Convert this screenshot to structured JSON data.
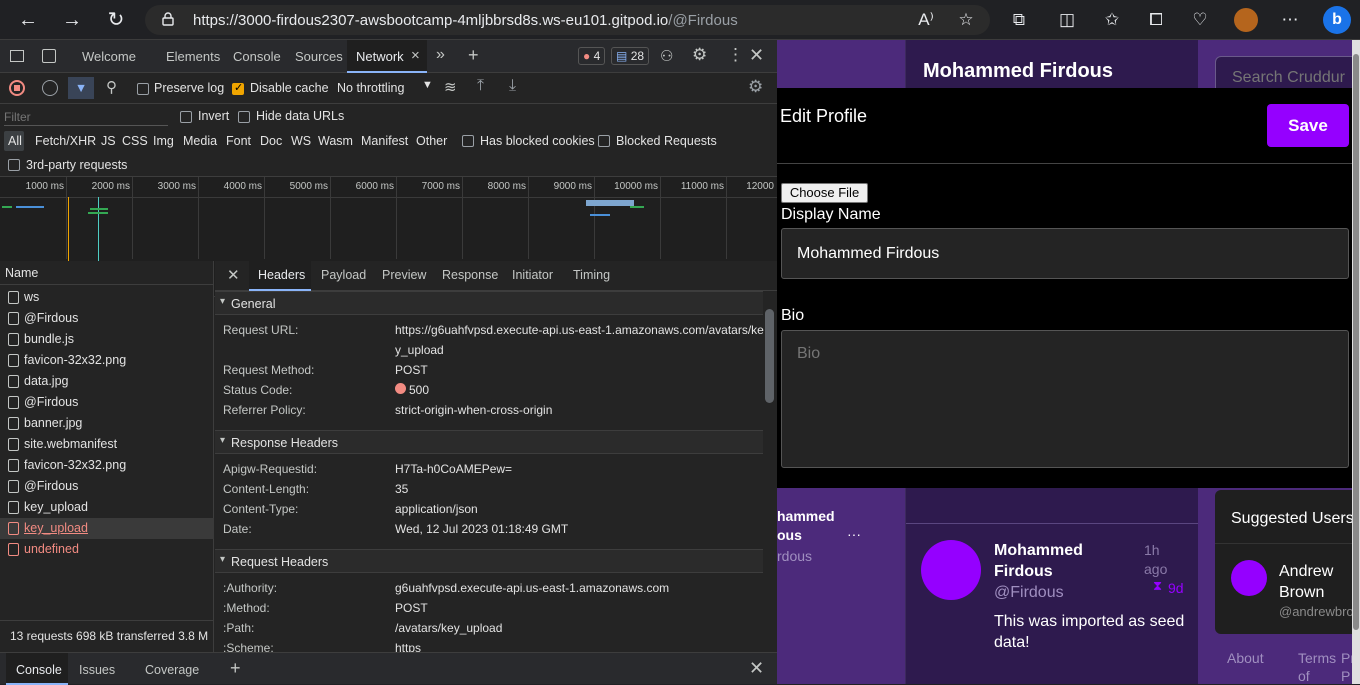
{
  "browser": {
    "url_host": "https://3000-firdous2307-awsbootcamp-4mljbbrsd8s.ws-eu101.gitpod.io",
    "url_path": "/@Firdous"
  },
  "devtools": {
    "tabs": [
      "Welcome",
      "Elements",
      "Console",
      "Sources",
      "Network"
    ],
    "active_tab": "Network",
    "error_count": "4",
    "message_count": "28",
    "toolbar": {
      "preserve_log": "Preserve log",
      "disable_cache": "Disable cache",
      "throttling": "No throttling"
    },
    "filter": {
      "placeholder": "Filter",
      "invert": "Invert",
      "hide_data_urls": "Hide data URLs",
      "types": [
        "All",
        "Fetch/XHR",
        "JS",
        "CSS",
        "Img",
        "Media",
        "Font",
        "Doc",
        "WS",
        "Wasm",
        "Manifest",
        "Other"
      ],
      "has_blocked_cookies": "Has blocked cookies",
      "blocked_requests": "Blocked Requests",
      "third_party": "3rd-party requests"
    },
    "timeline_ticks": [
      "1000 ms",
      "2000 ms",
      "3000 ms",
      "4000 ms",
      "5000 ms",
      "6000 ms",
      "7000 ms",
      "8000 ms",
      "9000 ms",
      "10000 ms",
      "11000 ms",
      "12000"
    ],
    "request_list": {
      "header": "Name",
      "items": [
        {
          "name": "ws",
          "error": false
        },
        {
          "name": "@Firdous",
          "error": false
        },
        {
          "name": "bundle.js",
          "error": false
        },
        {
          "name": "favicon-32x32.png",
          "error": false
        },
        {
          "name": "data.jpg",
          "error": false
        },
        {
          "name": "@Firdous",
          "error": false
        },
        {
          "name": "banner.jpg",
          "error": false
        },
        {
          "name": "site.webmanifest",
          "error": false
        },
        {
          "name": "favicon-32x32.png",
          "error": false
        },
        {
          "name": "@Firdous",
          "error": false
        },
        {
          "name": "key_upload",
          "error": false
        },
        {
          "name": "key_upload",
          "error": true
        },
        {
          "name": "undefined",
          "error": true
        }
      ],
      "footer": "13 requests   698 kB transferred   3.8 M"
    },
    "detail_tabs": [
      "Headers",
      "Payload",
      "Preview",
      "Response",
      "Initiator",
      "Timing"
    ],
    "general": {
      "title": "General",
      "request_url_k": "Request URL:",
      "request_url_v1": "https://g6uahfvpsd.execute-api.us-east-1.amazonaws.com/avatars/ke",
      "request_url_v2": "y_upload",
      "method_k": "Request Method:",
      "method_v": "POST",
      "status_k": "Status Code:",
      "status_v": "500",
      "referrer_k": "Referrer Policy:",
      "referrer_v": "strict-origin-when-cross-origin"
    },
    "response_headers": {
      "title": "Response Headers",
      "rows": [
        {
          "k": "Apigw-Requestid:",
          "v": "H7Ta-h0CoAMEPew="
        },
        {
          "k": "Content-Length:",
          "v": "35"
        },
        {
          "k": "Content-Type:",
          "v": "application/json"
        },
        {
          "k": "Date:",
          "v": "Wed, 12 Jul 2023 01:18:49 GMT"
        }
      ]
    },
    "request_headers": {
      "title": "Request Headers",
      "rows": [
        {
          "k": ":Authority:",
          "v": "g6uahfvpsd.execute-api.us-east-1.amazonaws.com"
        },
        {
          "k": ":Method:",
          "v": "POST"
        },
        {
          "k": ":Path:",
          "v": "/avatars/key_upload"
        },
        {
          "k": ":Scheme:",
          "v": "https"
        }
      ]
    },
    "drawer_tabs": [
      "Console",
      "Issues",
      "Coverage"
    ]
  },
  "app": {
    "profile_name": "Mohammed Firdous",
    "search_placeholder": "Search Cruddur",
    "modal": {
      "title": "Edit Profile",
      "save": "Save",
      "choose_file": "Choose File",
      "display_name_label": "Display Name",
      "display_name_value": "Mohammed Firdous",
      "bio_label": "Bio",
      "bio_placeholder": "Bio"
    },
    "left_profile": {
      "name1": "hammed",
      "name2": "ous",
      "handle": "rdous",
      "more": "···"
    },
    "post": {
      "name1": "Mohammed",
      "name2": "Firdous",
      "handle": "@Firdous",
      "time1": "1h",
      "time2": "ago",
      "expires": "9d",
      "text1": "This was imported as seed",
      "text2": "data!"
    },
    "suggested": {
      "title": "Suggested Users",
      "name1": "Andrew",
      "name2": "Brown",
      "handle": "@andrewbro"
    },
    "footer_links": [
      "About",
      "Terms",
      "of",
      "Pr",
      "P"
    ],
    "colors": {
      "accent": "#9500ff",
      "panel": "#4c2a7b",
      "bg": "#2e1a4e"
    }
  }
}
